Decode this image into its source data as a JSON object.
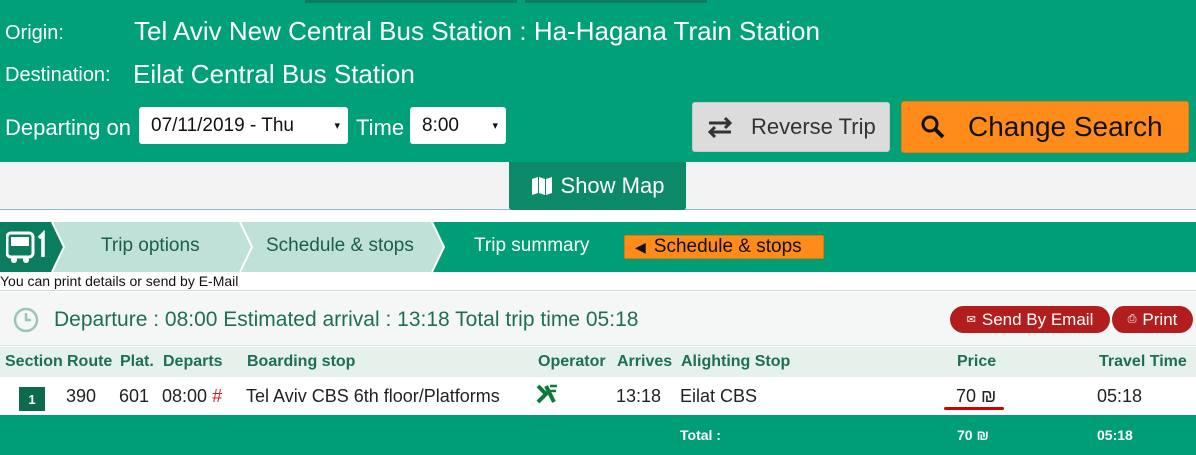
{
  "search": {
    "origin_label": "Origin:",
    "origin_value": "Tel Aviv New Central Bus Station : Ha-Hagana Train Station",
    "destination_label": "Destination:",
    "destination_value": "Eilat Central Bus Station",
    "departing_label": "Departing on",
    "date_value": "07/11/2019 - Thu",
    "time_label": "Time",
    "time_value": "8:00",
    "reverse_label": "Reverse Trip",
    "change_label": "Change Search",
    "caret": "▾"
  },
  "map": {
    "label": "Show Map"
  },
  "steps": {
    "items": [
      "Trip options",
      "Schedule & stops",
      "Trip summary"
    ],
    "back_label": "Schedule & stops",
    "back_arrow": "◀"
  },
  "hint": "You can print details or send by E-Mail",
  "summary": {
    "text": "Departure : 08:00 Estimated arrival : 13:18 Total trip time 05:18",
    "email_label": "Send By Email",
    "print_label": "Print"
  },
  "table": {
    "headers": [
      "Section",
      "Route",
      "Plat.",
      "Departs",
      "Boarding stop",
      "Operator",
      "Arrives",
      "Alighting Stop",
      "Price",
      "Travel Time"
    ],
    "row": {
      "section": "1",
      "route": "390",
      "platform": "601",
      "departs": "08:00",
      "departs_mark": "#",
      "boarding": "Tel Aviv CBS 6th floor/Platforms",
      "operator_icon": "operator-x-logo",
      "arrives": "13:18",
      "alighting": "Eilat CBS",
      "price": "70 ₪",
      "travel_time": "05:18"
    },
    "total_label": "Total :",
    "total_price": "70 ₪",
    "total_time": "05:18"
  },
  "colors": {
    "brand_green": "#00a078",
    "dark_green": "#0c8a68",
    "orange": "#ff8c1a",
    "red": "#b21e1e"
  }
}
